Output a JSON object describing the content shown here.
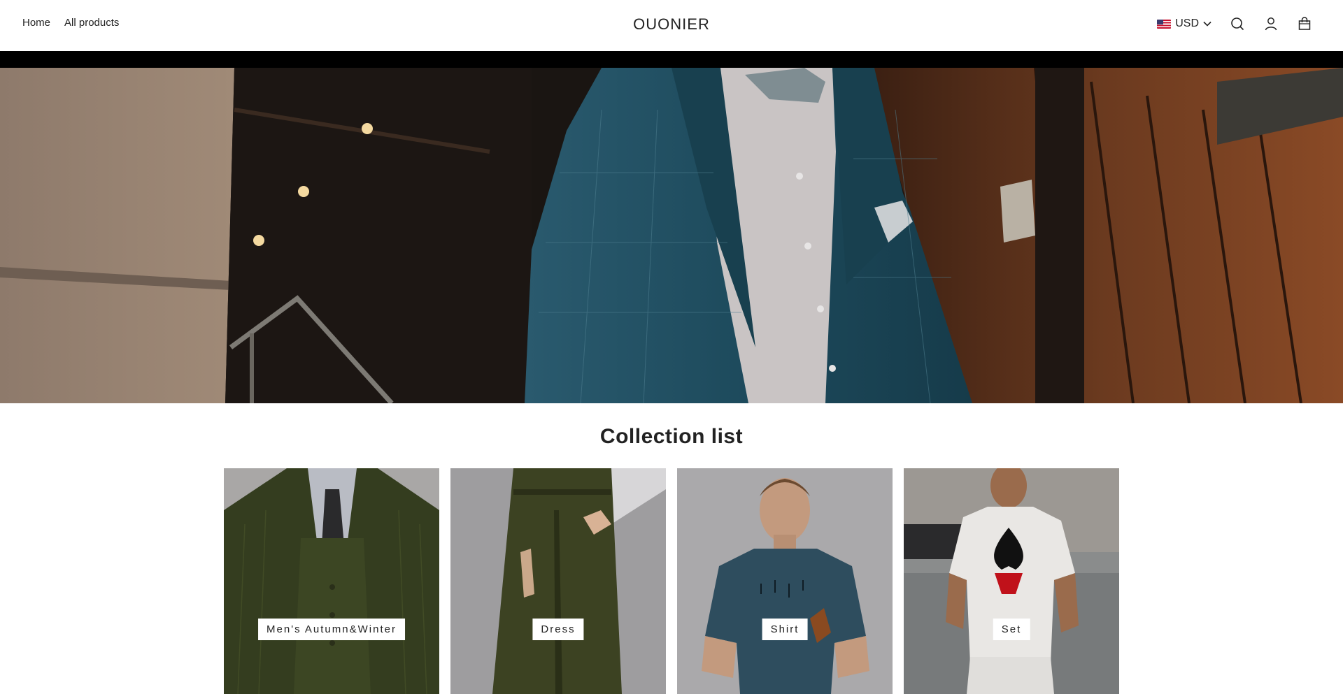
{
  "header": {
    "nav": [
      {
        "label": "Home"
      },
      {
        "label": "All products"
      }
    ],
    "brand": "OUONIER",
    "currency": {
      "code": "USD",
      "flag_icon": "us-flag-icon"
    },
    "icons": [
      "search-icon",
      "account-icon",
      "cart-icon"
    ]
  },
  "hero": {
    "image": "man-in-blue-plaid-suit-with-bow-tie"
  },
  "collection": {
    "title": "Collection list",
    "items": [
      {
        "label": "Men's Autumn&Winter",
        "image": "olive-corduroy-suit"
      },
      {
        "label": "Dress",
        "image": "olive-wide-leg-trousers"
      },
      {
        "label": "Shirt",
        "image": "man-in-blue-t-shirt"
      },
      {
        "label": "Set",
        "image": "white-printed-t-shirt-and-shorts-set"
      }
    ]
  },
  "colors": {
    "text": "#222222",
    "background": "#ffffff",
    "bar": "#000000",
    "suit": "#1d4a5c"
  }
}
